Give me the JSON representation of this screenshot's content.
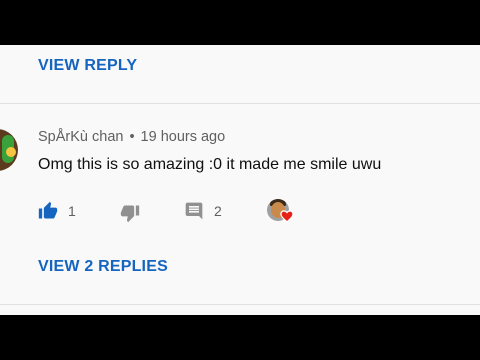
{
  "top_link": {
    "label": "VIEW REPLY"
  },
  "comment": {
    "author": "SpÅrKù chan",
    "separator": "•",
    "time": "19 hours ago",
    "text": "Omg this is so amazing :0 it made me smile uwu",
    "likes": "1",
    "replies": "2",
    "view_replies_label": "VIEW 2 REPLIES"
  },
  "icons": {
    "like": "thumbs-up-icon",
    "dislike": "thumbs-down-icon",
    "reply": "reply-comment-icon",
    "creator_heart": "creator-heart-badge"
  },
  "colors": {
    "link": "#1565c0",
    "like_active": "#1565c0",
    "heart": "#e62117",
    "muted": "#606060",
    "text": "#0f0f0f"
  }
}
